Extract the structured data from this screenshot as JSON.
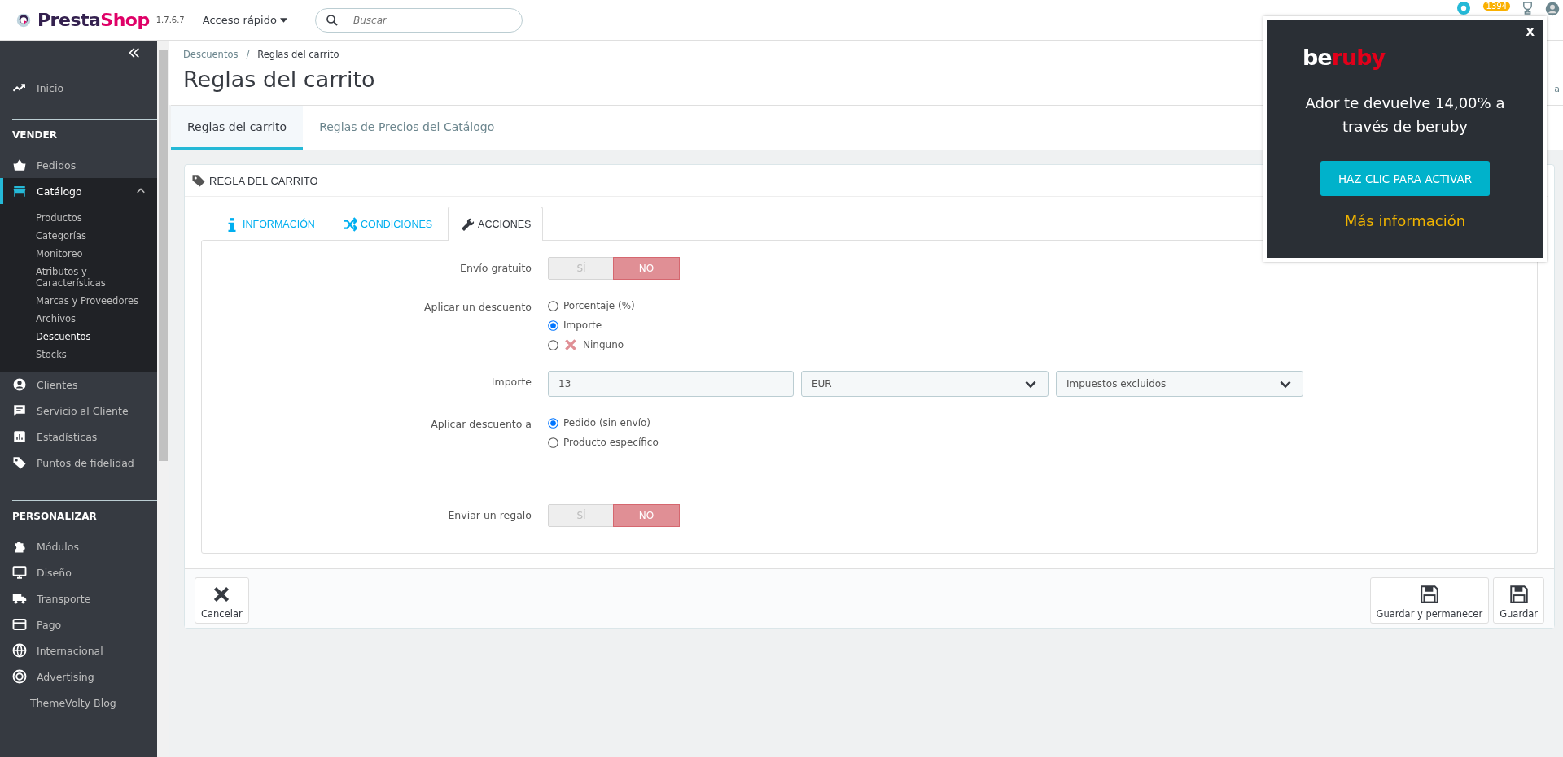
{
  "header": {
    "logo_parts": [
      "Presta",
      "Shop"
    ],
    "version": "1.7.6.7",
    "quick_access": "Acceso rápido",
    "search": {
      "placeholder": "Buscar"
    },
    "notification_count": "1394"
  },
  "sidebar": {
    "sections": [
      {
        "items": [
          {
            "label": "Inicio",
            "selected": false
          }
        ]
      },
      {
        "title": "VENDER",
        "items": [
          {
            "label": "Pedidos",
            "selected": false
          },
          {
            "label": "Catálogo",
            "selected": true,
            "expanded": true,
            "children": [
              {
                "label": "Productos",
                "selected": false
              },
              {
                "label": "Categorías",
                "selected": false
              },
              {
                "label": "Monitoreo",
                "selected": false
              },
              {
                "label": "Atributos y Características",
                "selected": false
              },
              {
                "label": "Marcas y Proveedores",
                "selected": false
              },
              {
                "label": "Archivos",
                "selected": false
              },
              {
                "label": "Descuentos",
                "selected": true
              },
              {
                "label": "Stocks",
                "selected": false
              }
            ]
          },
          {
            "label": "Clientes",
            "selected": false
          },
          {
            "label": "Servicio al Cliente",
            "selected": false
          },
          {
            "label": "Estadísticas",
            "selected": false
          },
          {
            "label": "Puntos de fidelidad",
            "selected": false
          }
        ]
      },
      {
        "title": "PERSONALIZAR",
        "items": [
          {
            "label": "Módulos",
            "selected": false
          },
          {
            "label": "Diseño",
            "selected": false
          },
          {
            "label": "Transporte",
            "selected": false
          },
          {
            "label": "Pago",
            "selected": false
          },
          {
            "label": "Internacional",
            "selected": false
          },
          {
            "label": "Advertising",
            "selected": false
          },
          {
            "label": "ThemeVolty Blog",
            "selected": false
          }
        ]
      }
    ]
  },
  "breadcrumb": [
    "Descuentos",
    "Reglas del carrito"
  ],
  "breadcrumb_separator": "/",
  "page_title": "Reglas del carrito",
  "toolbar_fragment": "a",
  "page_tabs": [
    {
      "label": "Reglas del carrito",
      "selected": true
    },
    {
      "label": "Reglas de Precios del Catálogo",
      "selected": false
    }
  ],
  "panel": {
    "title": "REGLA DEL CARRITO",
    "tabs": [
      {
        "label": "INFORMACIÓN",
        "selected": false
      },
      {
        "label": "CONDICIONES",
        "selected": false
      },
      {
        "label": "ACCIONES",
        "selected": true
      }
    ],
    "rows": [
      {
        "kind": "switch",
        "label": "Envío gratuito",
        "options": [
          {
            "label": "SÍ",
            "selected": false
          },
          {
            "label": "NO",
            "selected": true
          }
        ]
      },
      {
        "kind": "radio",
        "label": "Aplicar un descuento",
        "options": [
          {
            "label": "Porcentaje (%)",
            "selected": false,
            "kind": "plain"
          },
          {
            "label": "Importe",
            "selected": true,
            "kind": "plain"
          },
          {
            "label": "Ninguno",
            "selected": false,
            "kind": "cross"
          }
        ]
      },
      {
        "kind": "amount",
        "label": "Importe",
        "value": "13",
        "currency": "EUR",
        "tax": "Impuestos excluidos"
      },
      {
        "kind": "radio",
        "label": "Aplicar descuento a",
        "options": [
          {
            "label": "Pedido (sin envío)",
            "selected": true,
            "kind": "plain"
          },
          {
            "label": "Producto específico",
            "selected": false,
            "kind": "plain"
          }
        ]
      },
      {
        "kind": "switch",
        "label": "Enviar un regalo",
        "options": [
          {
            "label": "SÍ",
            "selected": false
          },
          {
            "label": "NO",
            "selected": true
          }
        ]
      }
    ],
    "buttons": [
      {
        "label": "Cancelar",
        "kind": "cancel"
      },
      {
        "label": "Guardar y permanecer",
        "kind": "save"
      },
      {
        "label": "Guardar",
        "kind": "save"
      }
    ]
  },
  "popup": {
    "logo_parts": [
      "be",
      "ruby"
    ],
    "message": "Ador te devuelve 14,00% a través de beruby",
    "button": "HAZ CLIC PARA ACTIVAR",
    "link": "Más información",
    "close": "X"
  }
}
